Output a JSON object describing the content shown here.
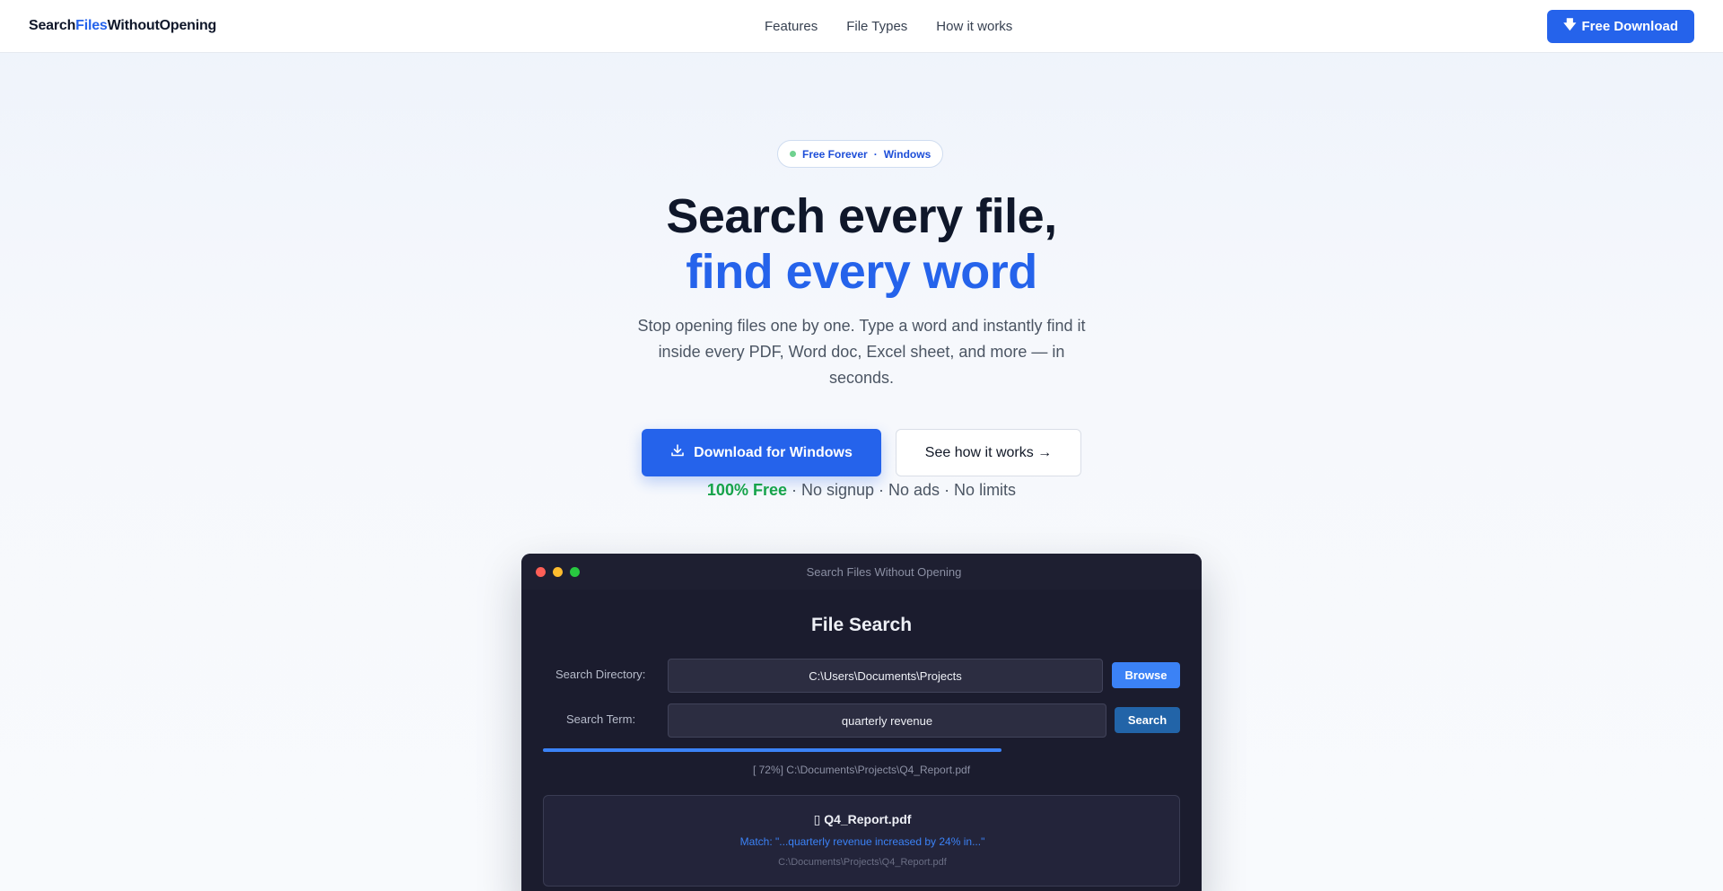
{
  "nav": {
    "logo": {
      "part1": "Search",
      "part2": "Files",
      "part3": "WithoutOpening"
    },
    "links": [
      "Features",
      "File Types",
      "How it works"
    ],
    "cta_label": "Free Download",
    "cta_icon": "download-arrow-icon"
  },
  "hero": {
    "badge": {
      "left": "Free Forever",
      "sep": "·",
      "right": "Windows"
    },
    "title_line1": "Search every file,",
    "title_line2": "find every word",
    "subtitle": "Stop opening files one by one. Type a word and instantly find it inside every PDF, Word doc, Excel sheet, and more — in seconds.",
    "primary_cta": "Download for Windows",
    "secondary_cta": "See how it works →",
    "free_highlight": "100% Free",
    "free_rest": " · No signup · No ads · No limits"
  },
  "app": {
    "window_title": "Search Files Without Opening",
    "heading": "File Search",
    "directory_label": "Search Directory:",
    "directory_value": "C:\\Users\\Documents\\Projects",
    "browse_label": "Browse",
    "term_label": "Search Term:",
    "term_value": "quarterly revenue",
    "search_label": "Search",
    "progress_percent": 72,
    "status_text": "[ 72%] C:\\Documents\\Projects\\Q4_Report.pdf",
    "result": {
      "icon": "file-icon",
      "name": "Q4_Report.pdf",
      "match": "Match: \"...quarterly revenue increased by 24% in...\"",
      "path": "C:\\Documents\\Projects\\Q4_Report.pdf"
    }
  },
  "colors": {
    "accent": "#2563eb",
    "free_green": "#16a34a",
    "window_bg": "#1b1c2e"
  }
}
